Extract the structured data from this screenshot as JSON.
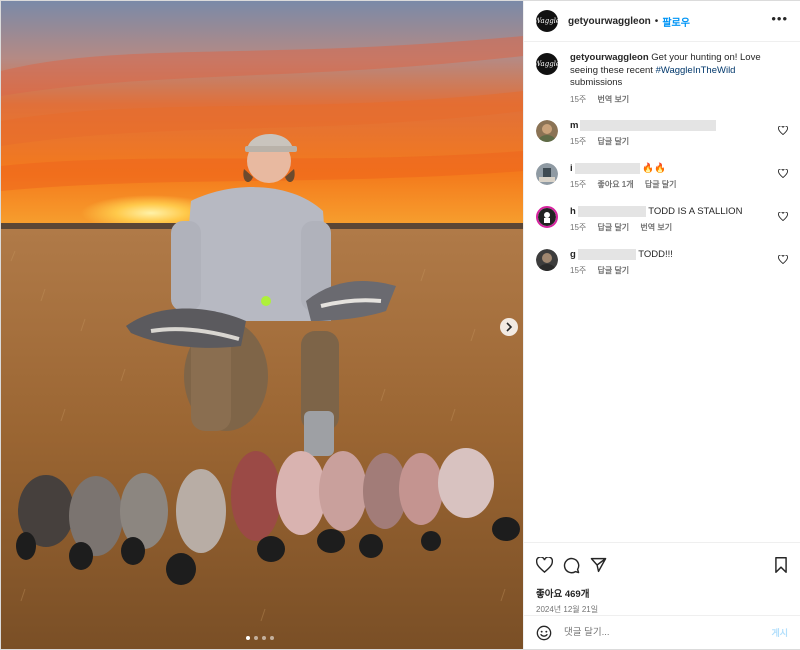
{
  "post": {
    "username": "getyourwaggleon",
    "separator": "•",
    "follow_label": "팔로우",
    "more_label": "•••",
    "logo_text": "Waggle"
  },
  "caption": {
    "username": "getyourwaggleon",
    "text": " Get your hunting on! Love seeing these recent ",
    "hashtag": "#WaggleInTheWild",
    "text_after": " submissions",
    "time": "15주",
    "translate_label": "번역 보기"
  },
  "comments": [
    {
      "user_initial": "m",
      "text": "",
      "time": "15주",
      "likes": "",
      "reply_label": "답글 달기",
      "translate_label": "",
      "avatar_color": "#8b7355"
    },
    {
      "user_initial": "i",
      "text": " 🔥🔥",
      "time": "15주",
      "likes": "좋아요 1개",
      "reply_label": "답글 달기",
      "translate_label": "",
      "avatar_color": "#6f7d86"
    },
    {
      "user_initial": "h",
      "text": " TODD IS A STALLION",
      "time": "15주",
      "likes": "",
      "reply_label": "답글 달기",
      "translate_label": "번역 보기",
      "avatar_color": "#222222"
    },
    {
      "user_initial": "g",
      "text": " TODD!!!",
      "time": "15주",
      "likes": "",
      "reply_label": "답글 달기",
      "translate_label": "",
      "avatar_color": "#3d3d3d"
    }
  ],
  "likes_label": "좋아요 469개",
  "date_label": "2024년 12월 21일",
  "add_comment": {
    "placeholder": "댓글 달기...",
    "post_label": "게시"
  },
  "carousel": {
    "total": 4,
    "active": 1
  },
  "colors": {
    "accent": "#0095f6",
    "hashtag": "#00376b",
    "muted": "#737373"
  }
}
